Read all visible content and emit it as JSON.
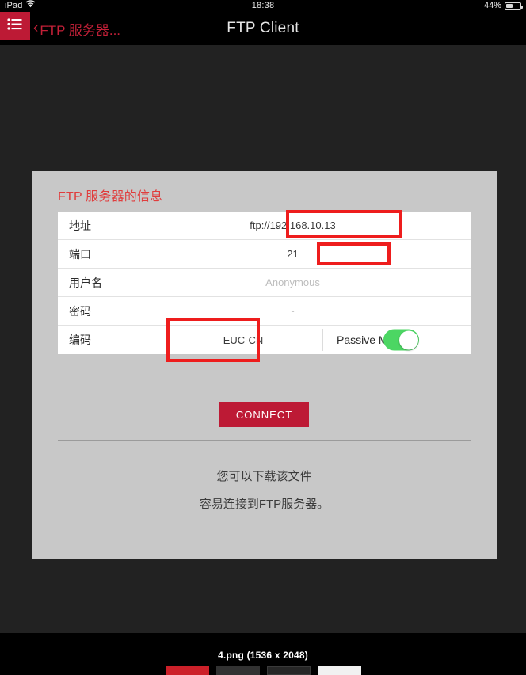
{
  "status_bar": {
    "device": "iPad",
    "wifi_icon": "wifi-icon",
    "time": "18:38",
    "battery_percent": "44%",
    "battery_level": 44
  },
  "nav_bar": {
    "menu_icon": "hamburger-list-icon",
    "back_chevron": "‹",
    "back_label": "FTP 服务器...",
    "title": "FTP Client"
  },
  "panel": {
    "title": "FTP 服务器的信息",
    "fields": [
      {
        "label": "地址",
        "value": "ftp://192.168.10.13",
        "is_placeholder": false
      },
      {
        "label": "端口",
        "value": "21",
        "is_placeholder": false
      },
      {
        "label": "用户名",
        "value": "Anonymous",
        "is_placeholder": true
      },
      {
        "label": "密码",
        "value": "-",
        "is_placeholder": true
      }
    ],
    "encoding_row": {
      "label": "编码",
      "value": "EUC-CN",
      "passive_label": "Passive Mode",
      "passive_enabled": true
    },
    "connect_label": "CONNECT",
    "notes": [
      "您可以下载该文件",
      "容易连接到FTP服务器。"
    ]
  },
  "annotations": [
    {
      "name": "address-highlight",
      "target": "ftp://192.168.10.13"
    },
    {
      "name": "port-highlight",
      "target": "21"
    },
    {
      "name": "encoding-highlight",
      "target": "EUC-CN"
    }
  ],
  "footer": {
    "caption": "4.png (1536 x 2048)"
  },
  "colors": {
    "accent_red": "#bd1a35",
    "title_red": "#e03c3c",
    "annotation_red": "#ee1d1d",
    "toggle_green": "#4cd663",
    "panel_gray": "#c8c8c8",
    "app_background": "#222222",
    "nav_background": "#000000"
  }
}
